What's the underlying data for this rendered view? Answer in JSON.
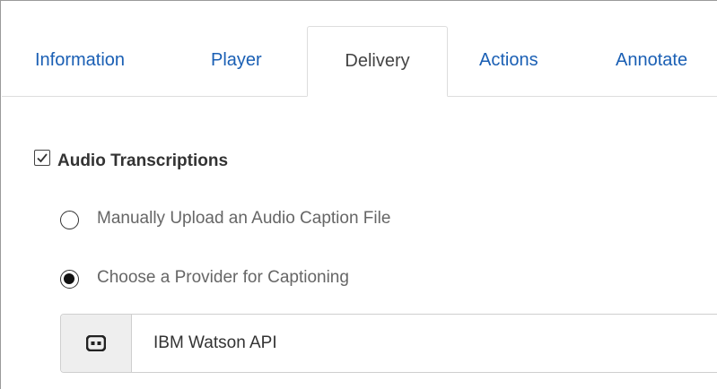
{
  "tabs": [
    {
      "label": "Information",
      "active": false
    },
    {
      "label": "Player",
      "active": false
    },
    {
      "label": "Delivery",
      "active": true
    },
    {
      "label": "Actions",
      "active": false
    },
    {
      "label": "Annotate",
      "active": false
    }
  ],
  "audio_transcriptions": {
    "label": "Audio Transcriptions",
    "checked": true,
    "options": [
      {
        "label": "Manually Upload an Audio Caption File",
        "selected": false
      },
      {
        "label": "Choose a Provider for Captioning",
        "selected": true
      }
    ],
    "provider": {
      "icon": "closed-captions-icon",
      "value": "IBM Watson API"
    }
  },
  "colors": {
    "tab_link": "#1a5fb4",
    "active_tab_text": "#444444",
    "border": "#dddddd",
    "addon_bg": "#eeeeee"
  }
}
